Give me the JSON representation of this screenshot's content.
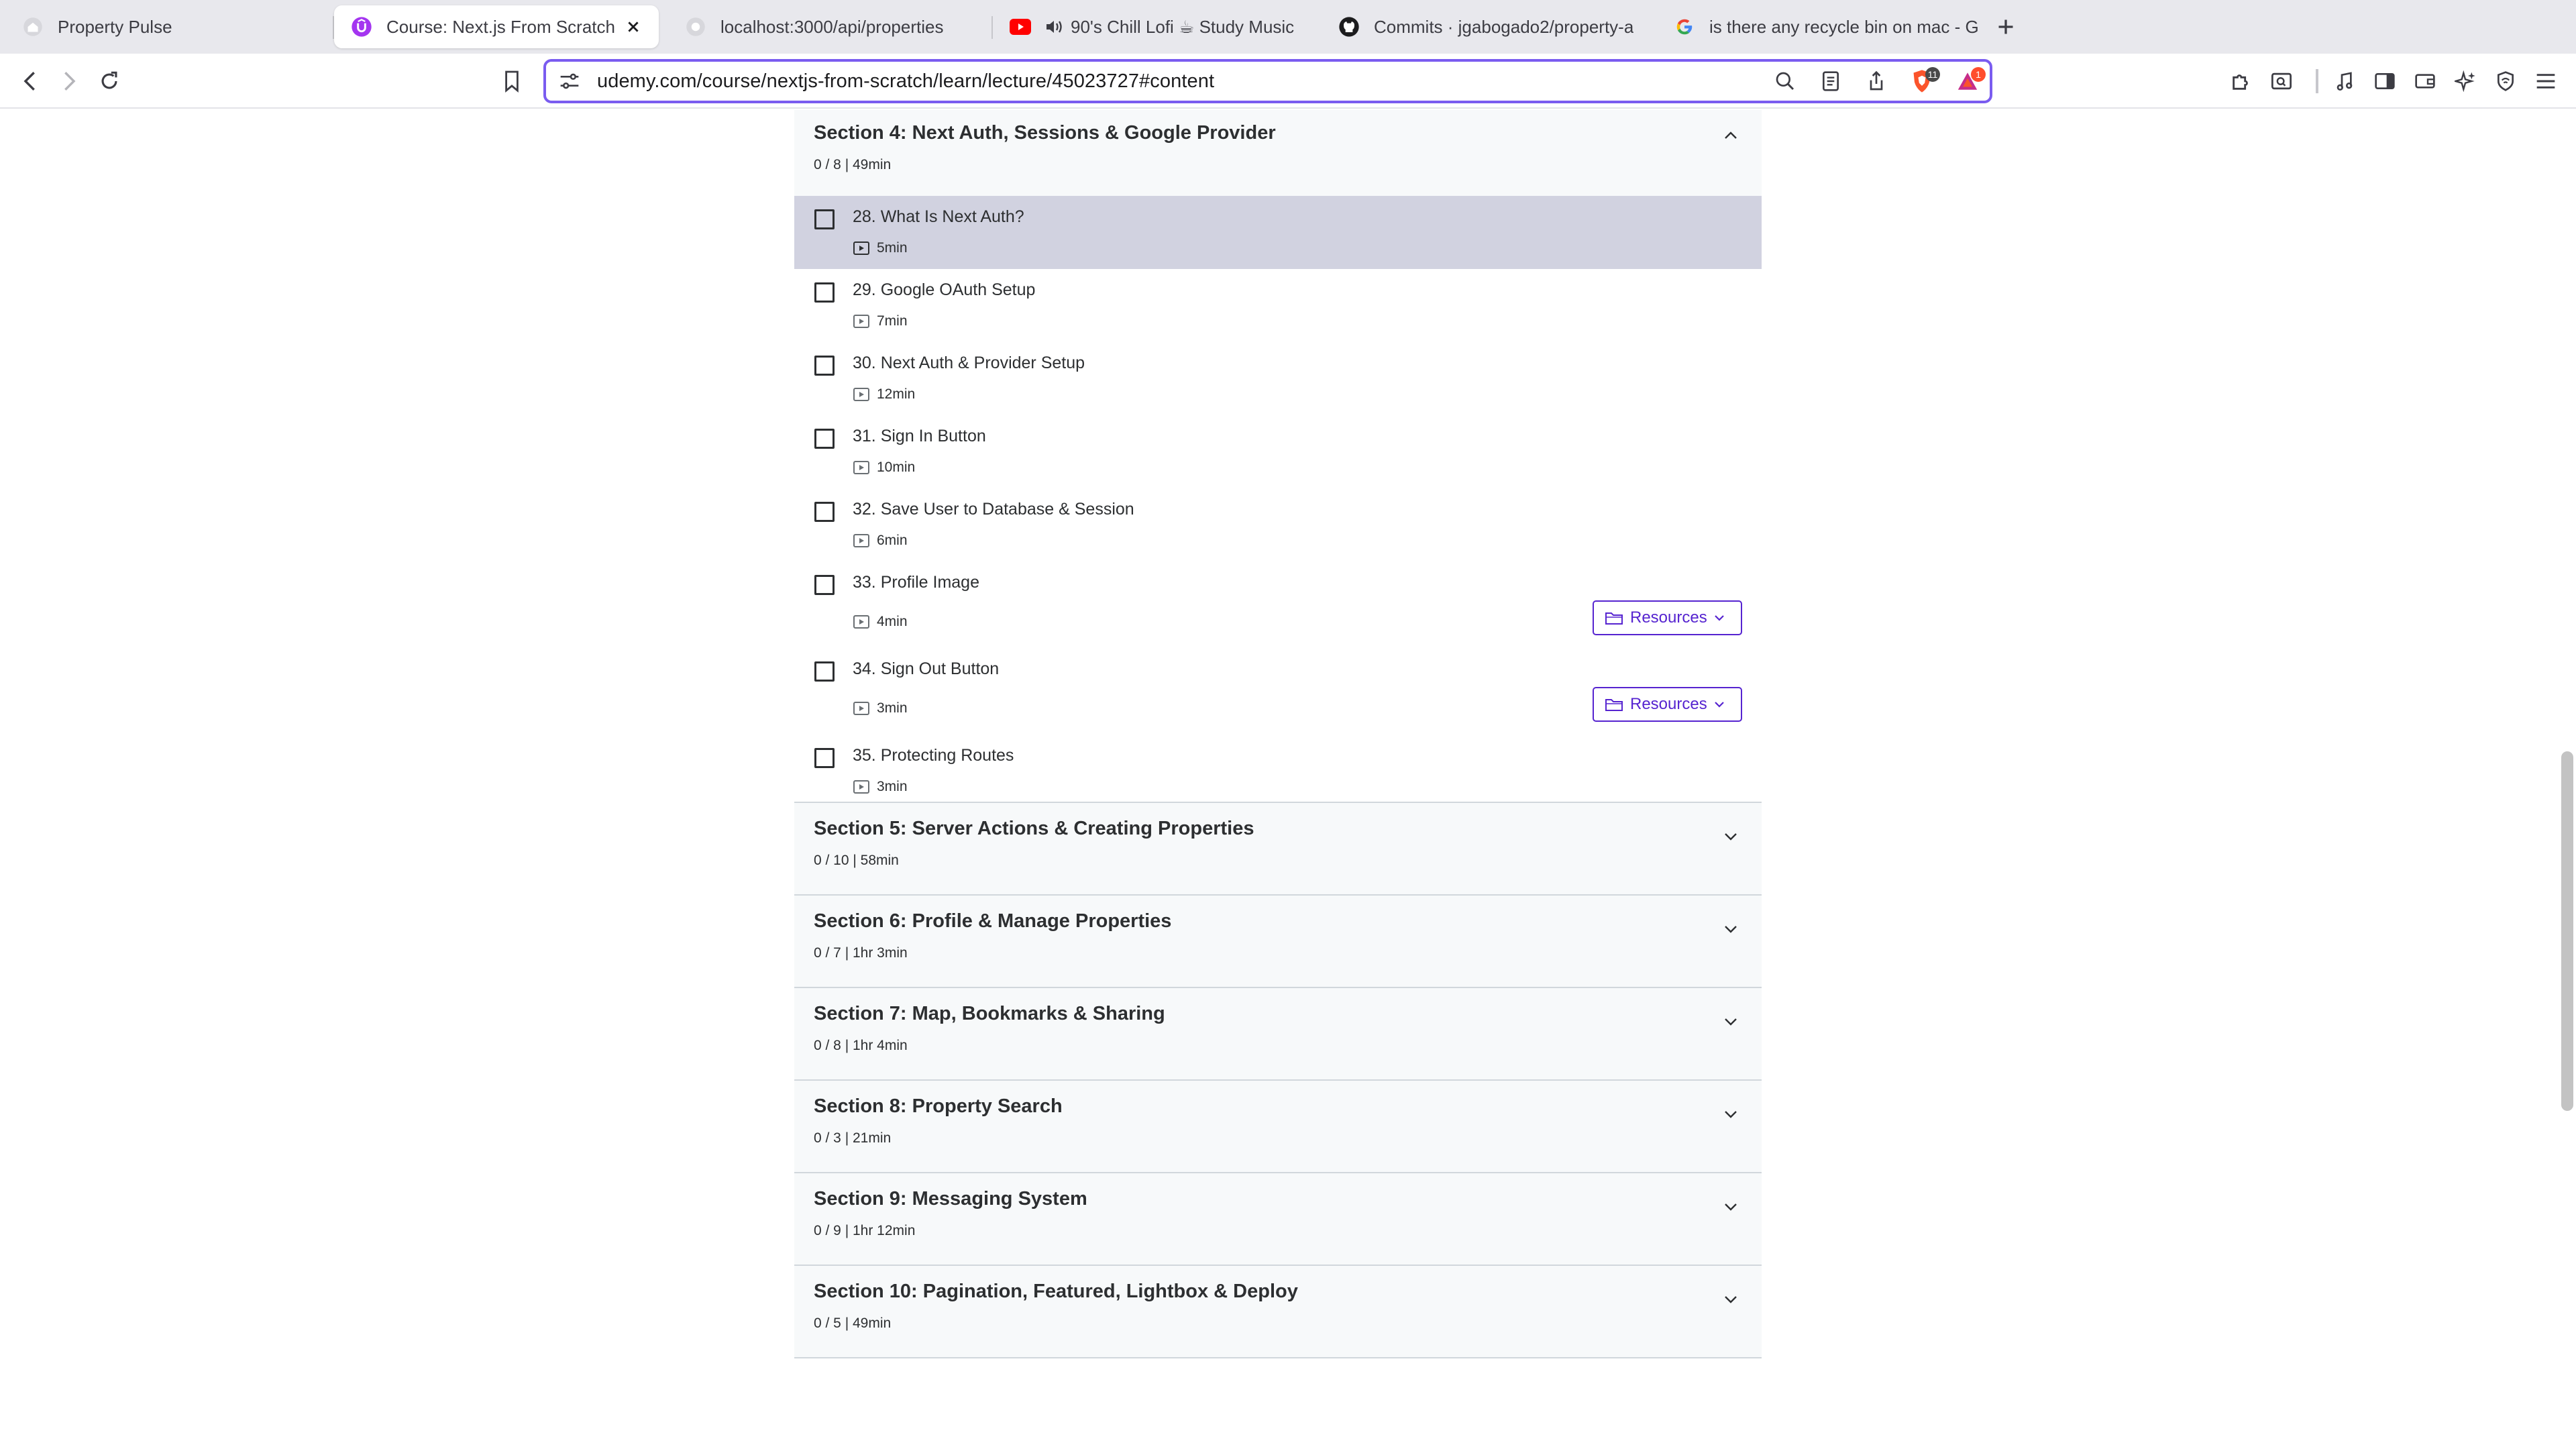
{
  "browser": {
    "tabs": [
      {
        "title": "Property Pulse",
        "active": false,
        "icon": "house-favicon"
      },
      {
        "title": "Course: Next.js From Scratch | ",
        "active": true,
        "icon": "udemy-favicon"
      },
      {
        "title": "localhost:3000/api/properties",
        "active": false,
        "icon": "globe-favicon"
      },
      {
        "title": "90's Chill Lofi ☕ Study Music ",
        "active": false,
        "icon": "youtube-favicon"
      },
      {
        "title": "Commits · jgabogado2/property-a",
        "active": false,
        "icon": "github-favicon"
      },
      {
        "title": "is there any recycle bin on mac - G",
        "active": false,
        "icon": "google-favicon"
      }
    ],
    "url": "udemy.com/course/nextjs-from-scratch/learn/lecture/45023727#content",
    "shields_badge": "11",
    "rewards_badge": "1",
    "accent": "#7a5cf0"
  },
  "curriculum": {
    "open_section": {
      "title": "Section 4: Next Auth, Sessions & Google Provider",
      "meta": "0 / 8 | 49min",
      "lectures": [
        {
          "title": "28. What Is Next Auth?",
          "duration": "5min",
          "active": true,
          "resources": false
        },
        {
          "title": "29. Google OAuth Setup",
          "duration": "7min",
          "active": false,
          "resources": false
        },
        {
          "title": "30. Next Auth & Provider Setup",
          "duration": "12min",
          "active": false,
          "resources": false
        },
        {
          "title": "31. Sign In Button",
          "duration": "10min",
          "active": false,
          "resources": false
        },
        {
          "title": "32. Save User to Database & Session",
          "duration": "6min",
          "active": false,
          "resources": false
        },
        {
          "title": "33. Profile Image",
          "duration": "4min",
          "active": false,
          "resources": true
        },
        {
          "title": "34. Sign Out Button",
          "duration": "3min",
          "active": false,
          "resources": true
        },
        {
          "title": "35. Protecting Routes",
          "duration": "3min",
          "active": false,
          "resources": false
        }
      ],
      "resources_label": "Resources"
    },
    "sections": [
      {
        "title": "Section 5: Server Actions & Creating Properties",
        "meta": "0 / 10 | 58min"
      },
      {
        "title": "Section 6: Profile & Manage Properties",
        "meta": "0 / 7 | 1hr 3min"
      },
      {
        "title": "Section 7: Map, Bookmarks & Sharing",
        "meta": "0 / 8 | 1hr 4min"
      },
      {
        "title": "Section 8: Property Search",
        "meta": "0 / 3 | 21min"
      },
      {
        "title": "Section 9: Messaging System",
        "meta": "0 / 9 | 1hr 12min"
      },
      {
        "title": "Section 10: Pagination, Featured, Lightbox & Deploy",
        "meta": "0 / 5 | 49min"
      }
    ],
    "colors": {
      "active_row": "#d1d2e0",
      "section_bg": "#f7f9fa",
      "resources": "#5624d0"
    }
  }
}
